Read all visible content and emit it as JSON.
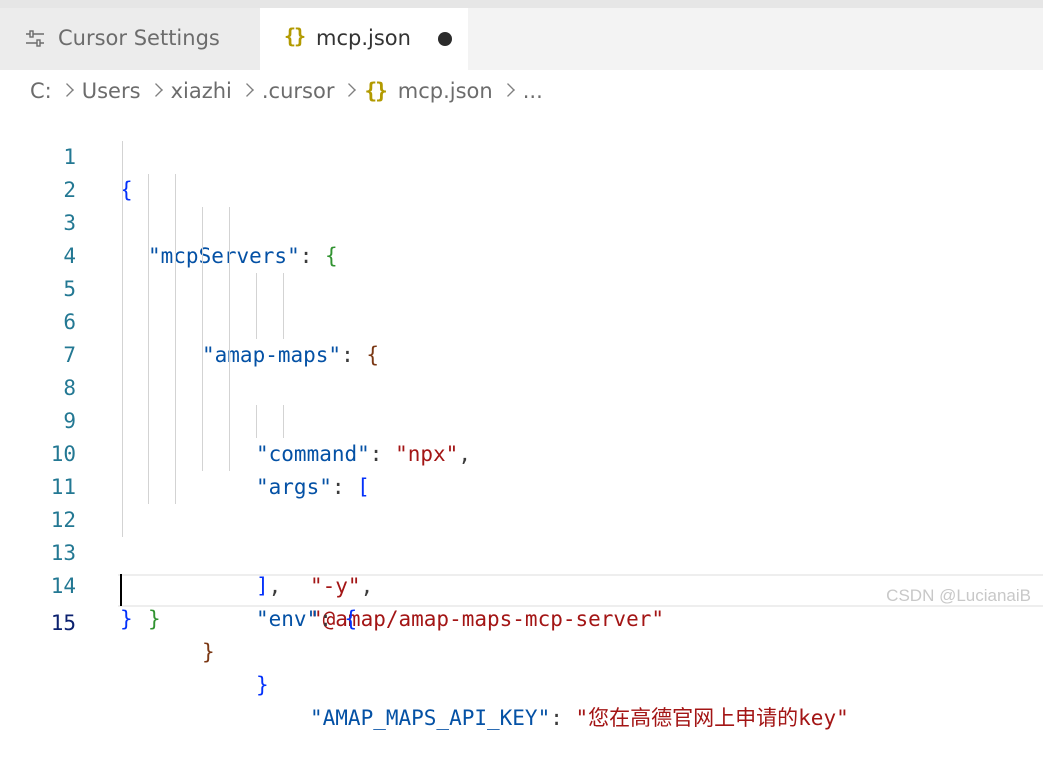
{
  "tabs": [
    {
      "label": "Cursor Settings",
      "icon": "settings-sliders-icon",
      "active": false
    },
    {
      "label": "mcp.json",
      "icon": "json-braces-icon",
      "icon_glyph": "{}",
      "active": true,
      "modified": true
    }
  ],
  "breadcrumb": {
    "segments": [
      "C:",
      "Users",
      "xiazhi",
      ".cursor",
      "mcp.json",
      "..."
    ],
    "json_icon_glyph": "{}"
  },
  "editor": {
    "line_numbers": [
      "1",
      "2",
      "3",
      "4",
      "5",
      "6",
      "7",
      "8",
      "9",
      "10",
      "11",
      "12",
      "13",
      "14",
      "15"
    ],
    "tokens": {
      "l1_b": "{",
      "l2_key": "\"mcpServers\"",
      "l2_colon": ": ",
      "l2_b": "{",
      "l3_key": "\"amap-maps\"",
      "l3_colon": ": ",
      "l3_b": "{",
      "l4_key": "\"command\"",
      "l4_colon": ": ",
      "l4_val": "\"npx\"",
      "l4_comma": ",",
      "l5_key": "\"args\"",
      "l5_colon": ": ",
      "l5_b": "[",
      "l6_val": "\"-y\"",
      "l6_comma": ",",
      "l7_val": "\"@amap/amap-maps-mcp-server\"",
      "l8_b": "]",
      "l8_comma": ",",
      "l9_key": "\"env\"",
      "l9_colon": ": ",
      "l9_b": "{",
      "l10_key": "\"AMAP_MAPS_API_KEY\"",
      "l10_colon": ": ",
      "l10_val": "\"您在高德官网上申请的key\"",
      "l11_b": "}",
      "l12_b": "}",
      "l13_b": "}",
      "l14_b": "}"
    }
  },
  "watermark": "CSDN @LucianaiB",
  "colors": {
    "key": "#0451a5",
    "string": "#a31515",
    "bracket_level1": "#0431fa",
    "bracket_level2": "#319331",
    "bracket_level3": "#7b3814",
    "line_number": "#237893"
  }
}
